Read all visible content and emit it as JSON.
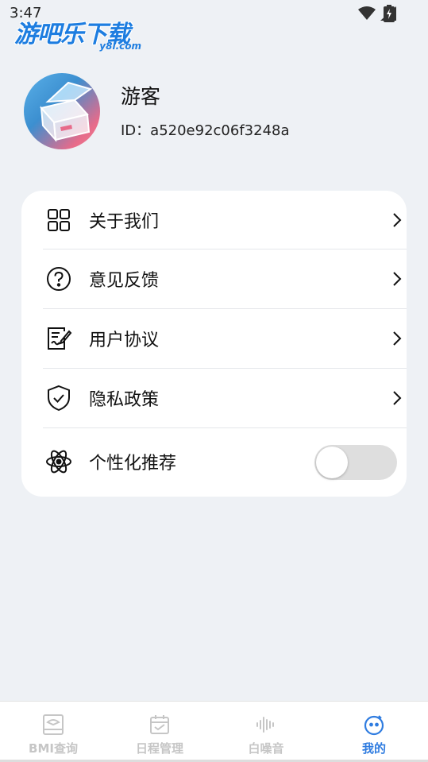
{
  "status": {
    "time": "3:47"
  },
  "watermark": {
    "title": "游吧乐下载",
    "sub": "y8l.com"
  },
  "profile": {
    "name": "游客",
    "id_label": "ID：a520e92c06f3248a"
  },
  "menu": {
    "items": [
      {
        "label": "关于我们",
        "icon": "grid-icon"
      },
      {
        "label": "意见反馈",
        "icon": "question-icon"
      },
      {
        "label": "用户协议",
        "icon": "document-sign-icon"
      },
      {
        "label": "隐私政策",
        "icon": "shield-check-icon"
      }
    ],
    "personalized": {
      "label": "个性化推荐",
      "icon": "atom-icon",
      "enabled": false
    }
  },
  "tabs": [
    {
      "label": "BMI查询",
      "icon": "scale-icon",
      "active": false
    },
    {
      "label": "日程管理",
      "icon": "calendar-icon",
      "active": false
    },
    {
      "label": "白噪音",
      "icon": "sound-wave-icon",
      "active": false
    },
    {
      "label": "我的",
      "icon": "face-icon",
      "active": true
    }
  ],
  "colors": {
    "accent": "#2f7ce0",
    "inactive": "#c6c6c6",
    "background": "#eef1f5"
  }
}
